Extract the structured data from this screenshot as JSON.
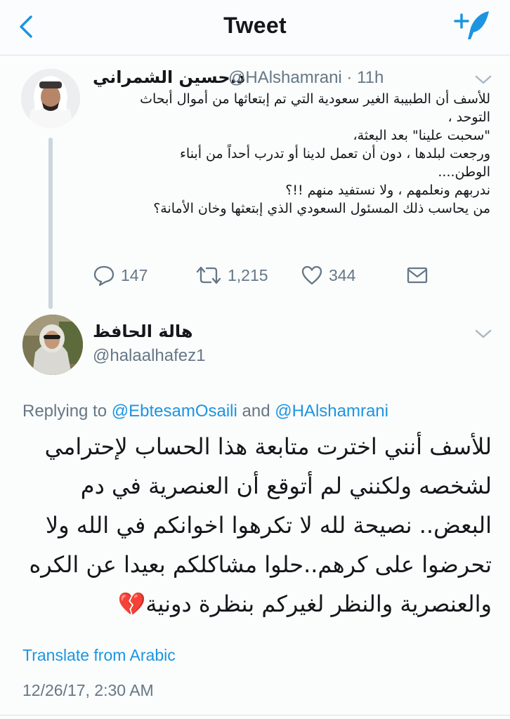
{
  "header": {
    "title": "Tweet"
  },
  "parent_tweet": {
    "author_name": "د.حسين الشمراني",
    "handle_time": "@HAlshamrani · 11h",
    "lines": [
      "للأسف أن الطبيبة الغير سعودية التي تم إبتعاثها من أموال أبحاث",
      "التوحد ،",
      "\"سحبت علينا\" بعد البعثة،",
      "ورجعت لبلدها ، دون أن تعمل لدينا أو  تدرب أحداً من أبناء",
      "الوطن....",
      "ندربهم ونعلمهم ، ولا نستفيد منهم !!؟",
      "من يحاسب ذلك المسئول السعودي الذي إبتعثها وخان الأمانة؟"
    ],
    "replies": "147",
    "retweets": "1,215",
    "likes": "344"
  },
  "reply_tweet": {
    "author_name": "هالة الحافظ",
    "handle": "@halaalhafez1",
    "replying_prefix": "Replying to ",
    "mention1": "@EbtesamOsaili",
    "and_text": " and ",
    "mention2": "@HAlshamrani",
    "lines": [
      "للأسف أنني اخترت متابعة هذا الحساب لإحترامي",
      "لشخصه ولكنني لم أتوقع أن العنصرية في دم",
      "البعض.. نصيحة لله لا تكرهوا اخوانكم في الله ولا",
      "تحرضوا على كرهم..حلوا مشاكلكم بعيدا عن الكره",
      "والعنصرية والنظر لغيركم بنظرة دونية💔"
    ],
    "translate": "Translate from Arabic",
    "timestamp": "12/26/17, 2:30 AM"
  },
  "colors": {
    "accent": "#1b95e0",
    "muted": "#657786",
    "text": "#14171a"
  },
  "icons": [
    "back-chevron-icon",
    "compose-tweet-icon",
    "caret-down-icon",
    "reply-icon",
    "retweet-icon",
    "like-heart-icon",
    "direct-message-icon"
  ]
}
